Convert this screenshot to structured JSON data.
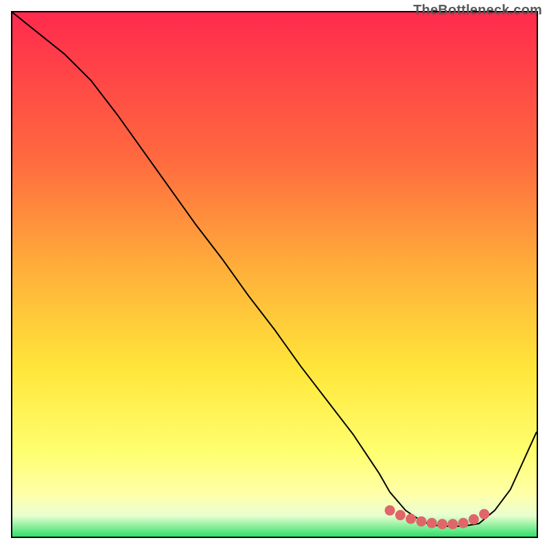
{
  "watermark": "TheBottleneck.com",
  "chart_data": {
    "type": "line",
    "title": "",
    "xlabel": "",
    "ylabel": "",
    "xlim": [
      0,
      100
    ],
    "ylim": [
      0,
      100
    ],
    "grid": false,
    "legend": false,
    "series": [
      {
        "name": "curve",
        "x": [
          0,
          5,
          10,
          15,
          20,
          25,
          30,
          35,
          40,
          45,
          50,
          55,
          60,
          65,
          70,
          72,
          75,
          78,
          80,
          83,
          86,
          89,
          92,
          95,
          100
        ],
        "y": [
          100,
          96,
          92,
          87,
          80.5,
          73.5,
          66.5,
          59.5,
          53,
          46,
          39.5,
          32.5,
          26,
          19.5,
          12,
          8.5,
          5,
          3,
          2.2,
          2,
          2,
          2.5,
          5,
          9,
          20
        ]
      },
      {
        "name": "optimal-markers",
        "type": "scatter",
        "x": [
          72,
          74,
          76,
          78,
          80,
          82,
          84,
          86,
          88,
          90
        ],
        "y": [
          5,
          4.1,
          3.4,
          2.9,
          2.6,
          2.4,
          2.4,
          2.6,
          3.3,
          4.3
        ]
      }
    ],
    "colors": {
      "gradient_top": "#ff2a4d",
      "gradient_mid1": "#ff8a3a",
      "gradient_mid2": "#ffe63a",
      "gradient_mid3": "#ffff8a",
      "gradient_bottom": "#2fe06a",
      "marker": "#e06669"
    }
  }
}
